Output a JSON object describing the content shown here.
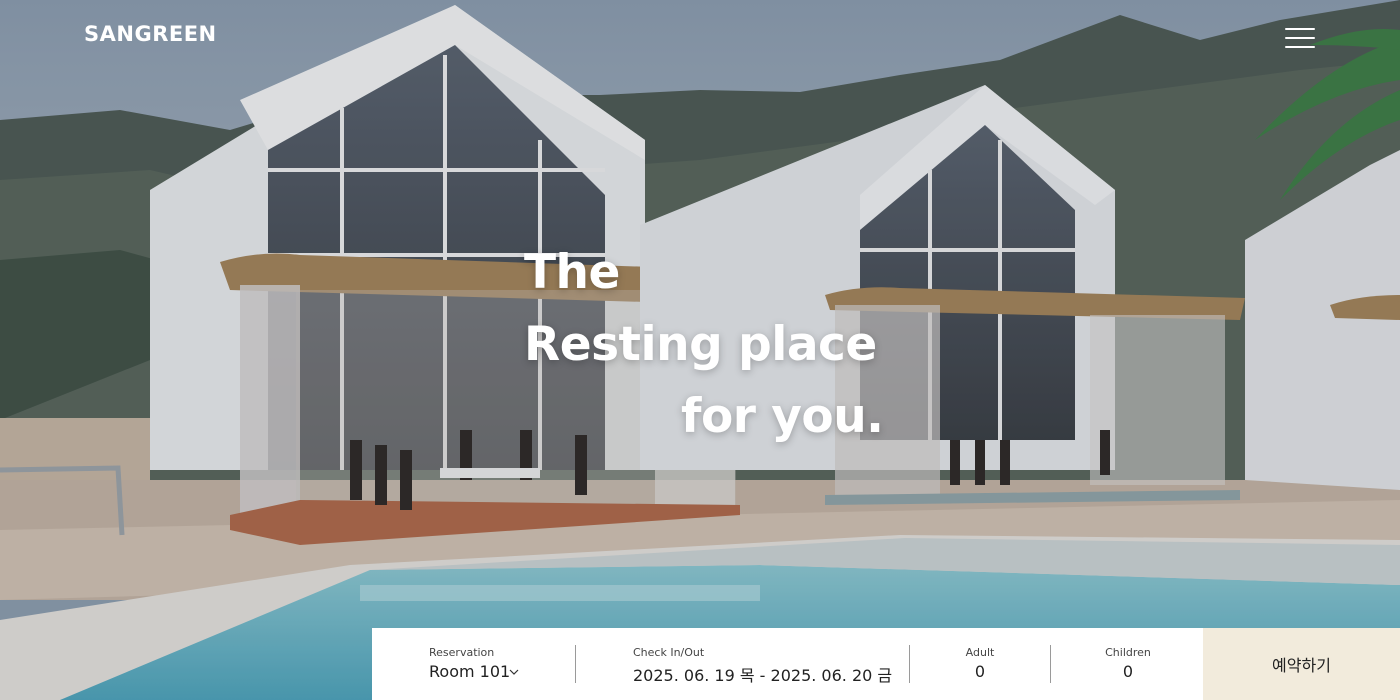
{
  "header": {
    "logo": "SANGREEN",
    "menu_icon": "hamburger-menu-icon"
  },
  "hero": {
    "line1": "The",
    "line2": "Resting place",
    "line3": "for you."
  },
  "booking": {
    "reservation_label": "Reservation",
    "reservation_value": "Room 101",
    "dates_label": "Check In/Out",
    "dates_value": "2025. 06. 19 목 - 2025. 06. 20 금",
    "adult_label": "Adult",
    "adult_value": "0",
    "children_label": "Children",
    "children_value": "0",
    "reserve_label": "예약하기",
    "chevron_icon": "chevron-down-icon"
  },
  "colors": {
    "reserve_button_bg": "#f2ebdc",
    "booking_bar_bg": "#ffffff",
    "pool": "#7cc3cf"
  }
}
